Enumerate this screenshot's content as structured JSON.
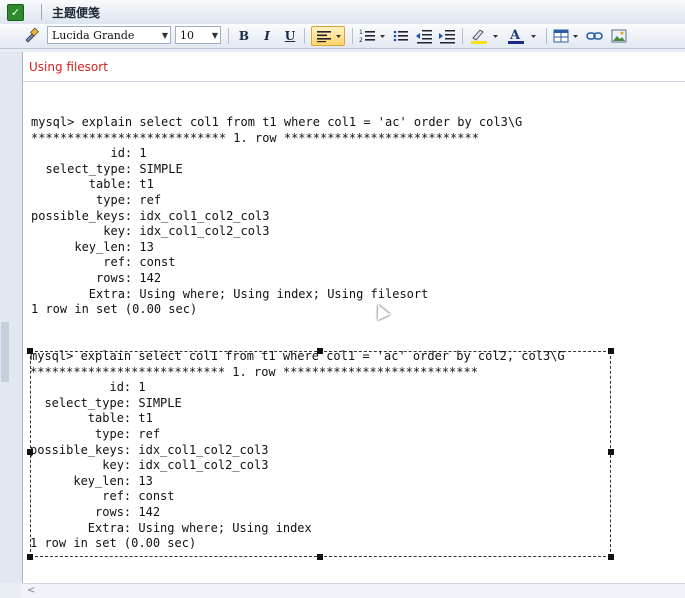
{
  "window": {
    "title": "主题便笺",
    "app_icon": "note-check-icon"
  },
  "toolbar": {
    "brush_icon": "format-painter-icon",
    "font_family": "Lucida Grande",
    "font_size": "10",
    "bold": "B",
    "italic": "I",
    "underline": "U",
    "icons": [
      "align-left-icon",
      "numbered-list-icon",
      "bullet-list-icon",
      "decrease-indent-icon",
      "increase-indent-icon",
      "highlight-color-icon",
      "font-color-icon",
      "table-icon",
      "link-icon",
      "image-icon"
    ]
  },
  "editor": {
    "status": "Using filesort",
    "block1": "mysql> explain select col1 from t1 where col1 = 'ac' order by col3\\G\n*************************** 1. row ***************************\n           id: 1\n  select_type: SIMPLE\n        table: t1\n         type: ref\npossible_keys: idx_col1_col2_col3\n          key: idx_col1_col2_col3\n      key_len: 13\n          ref: const\n         rows: 142\n        Extra: Using where; Using index; Using filesort\n1 row in set (0.00 sec)",
    "block2": "mysql> explain select col1 from t1 where col1 = 'ac' order by col2, col3\\G\n*************************** 1. row ***************************\n           id: 1\n  select_type: SIMPLE\n        table: t1\n         type: ref\npossible_keys: idx_col1_col2_col3\n          key: idx_col1_col2_col3\n      key_len: 13\n          ref: const\n         rows: 142\n        Extra: Using where; Using index\n1 row in set (0.00 sec)"
  },
  "colors": {
    "status_text": "#d42121",
    "toolbar_bg": "#e3e9f1",
    "editor_bg": "#ffffff"
  }
}
